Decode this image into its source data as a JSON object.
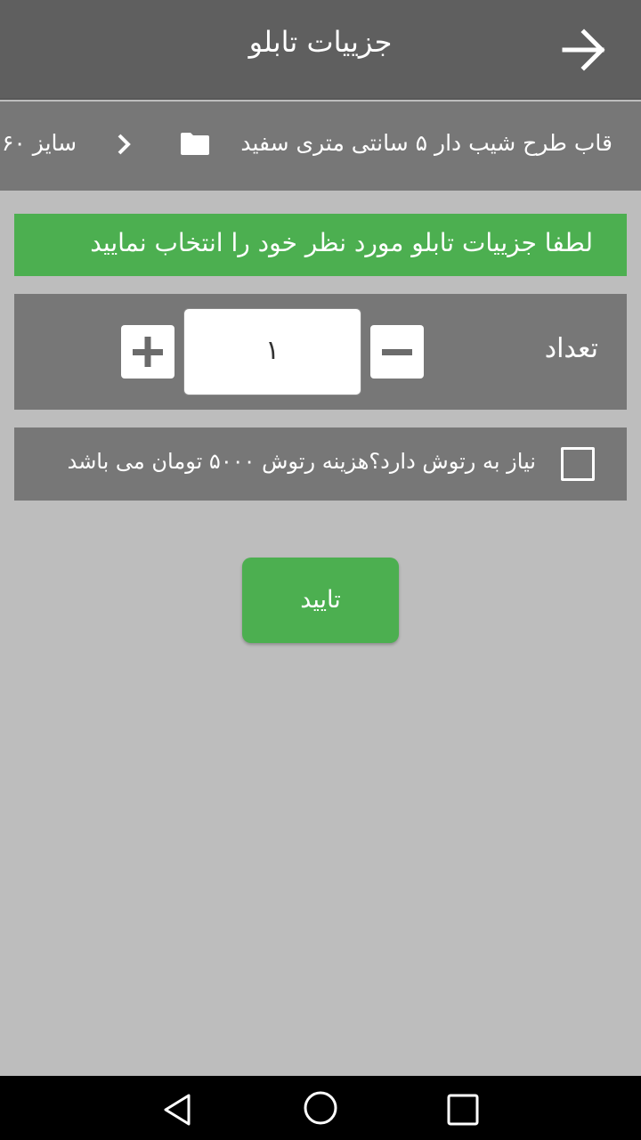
{
  "appbar": {
    "title": "جزییات تابلو",
    "back_icon": "arrow-right-icon"
  },
  "breadcrumb": {
    "item_main": "قاب طرح شیب دار ۵ سانتی متری سفید",
    "item_size": "سایز ۶۰",
    "folder_icon": "folder-icon",
    "separator_icon": "chevron-right-icon"
  },
  "banner": {
    "text": "لطفا جزییات تابلو مورد نظر خود را انتخاب نمایید",
    "color": "#4caf50"
  },
  "quantity": {
    "label": "تعداد",
    "value": "۱"
  },
  "retouch": {
    "label": "نیاز به رتوش دارد؟هزینه رتوش ۵۰۰۰ تومان می باشد",
    "checked": false
  },
  "confirm": {
    "label": "تایید"
  },
  "navbar": {
    "icons": [
      "back-triangle-icon",
      "home-circle-icon",
      "recents-square-icon"
    ]
  }
}
